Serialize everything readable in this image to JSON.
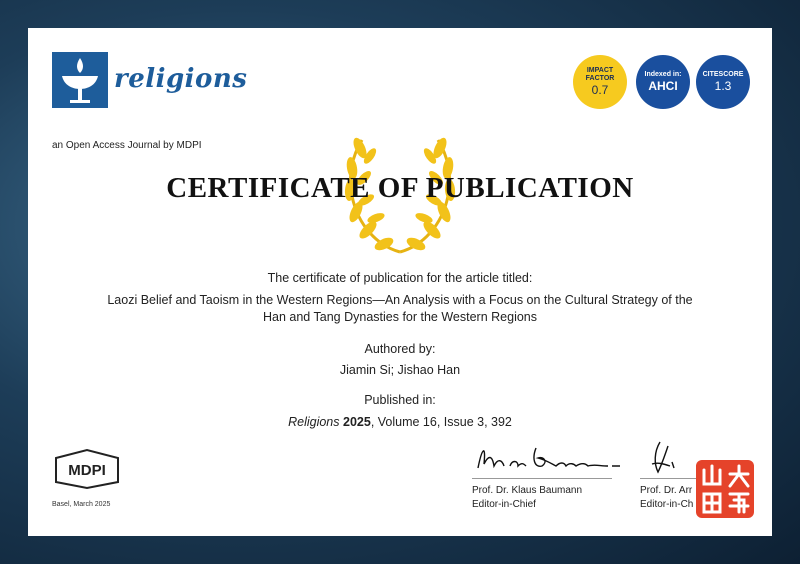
{
  "journal": {
    "name": "religions",
    "tagline": "an Open Access Journal by MDPI"
  },
  "badges": {
    "impact": {
      "label": "IMPACT FACTOR",
      "value": "0.7"
    },
    "indexed": {
      "label": "Indexed in:",
      "value": "AHCI"
    },
    "citescore": {
      "label": "CITESCORE",
      "value": "1.3"
    }
  },
  "certificate": {
    "title": "CERTIFICATE OF PUBLICATION",
    "intro": "The certificate of publication for the article titled:",
    "article_title_line1": "Laozi Belief and Taoism in the Western Regions—An Analysis with a Focus on the Cultural Strategy of the",
    "article_title_line2": "Han and Tang Dynasties for the Western Regions",
    "authored_by_label": "Authored by:",
    "authors": "Jiamin Si; Jishao Han",
    "published_in_label": "Published in:",
    "pub_journal": "Religions",
    "pub_year": "2025",
    "pub_details": ", Volume 16, Issue 3, 392"
  },
  "footer": {
    "publisher": "MDPI",
    "place_date": "Basel, March 2025",
    "signer1": {
      "name": "Prof. Dr. Klaus Baumann",
      "role": "Editor-in-Chief"
    },
    "signer2": {
      "name": "Prof. Dr. Arr",
      "role": "Editor-in-Ch"
    }
  },
  "colors": {
    "brand_blue": "#1e5d9b",
    "badge_yellow": "#f6ca1f",
    "wreath_gold": "#f2c21a",
    "watermark_red": "#e5432a"
  }
}
